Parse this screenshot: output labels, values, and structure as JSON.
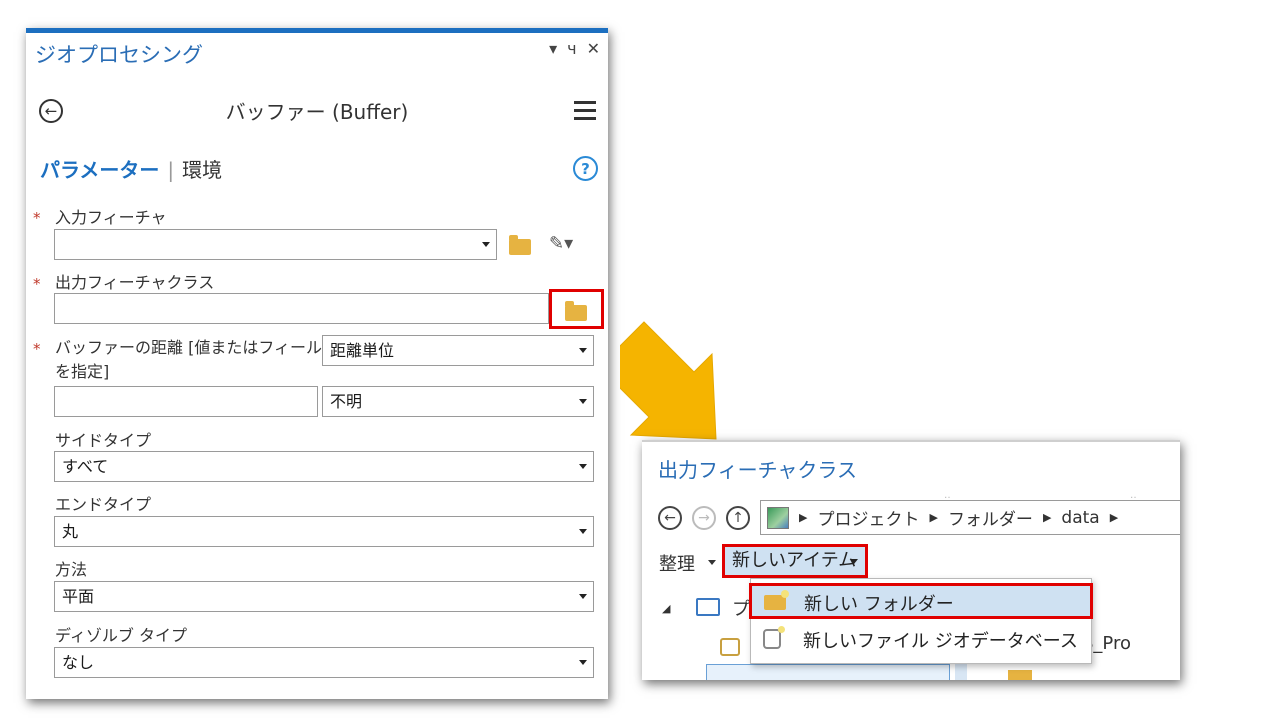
{
  "pane": {
    "title": "ジオプロセシング",
    "controls": {
      "dropdown": "▾",
      "pin": "ч",
      "close": "✕"
    },
    "tool_title": "バッファー (Buffer)",
    "tabs": {
      "parameters": "パラメーター",
      "separator": "|",
      "environments": "環境"
    },
    "help": "?",
    "required_mark": "*",
    "fields": {
      "input_label": "入力フィーチャ",
      "input_value": "",
      "output_label": "出力フィーチャクラス",
      "output_value": "",
      "distance_label_line1": "バッファーの距離 [値またはフィールド",
      "distance_label_line2": "を指定]",
      "distance_type_value": "距離単位",
      "distance_value": "",
      "distance_unit_value": "不明",
      "side_type_label": "サイドタイプ",
      "side_type_value": "すべて",
      "end_type_label": "エンドタイプ",
      "end_type_value": "丸",
      "method_label": "方法",
      "method_value": "平面",
      "dissolve_label": "ディゾルブ タイプ",
      "dissolve_value": "なし"
    }
  },
  "dialog": {
    "title": "出力フィーチャクラス",
    "path": [
      "プロジェクト",
      "フォルダー",
      "data"
    ],
    "organize_label": "整理",
    "new_item_label": "新しいアイテム",
    "tree_root_partial": "プ",
    "right_partial_text": "S_Pro",
    "menu": [
      {
        "label": "新しい フォルダー",
        "icon": "new-folder-icon"
      },
      {
        "label": "新しいファイル ジオデータベース",
        "icon": "new-geodatabase-icon"
      }
    ]
  },
  "colors": {
    "accent": "#1c6fc0",
    "highlight_red": "#e00000",
    "arrow": "#f5b400",
    "folder": "#e6b341",
    "selection": "#cfe1f2"
  }
}
